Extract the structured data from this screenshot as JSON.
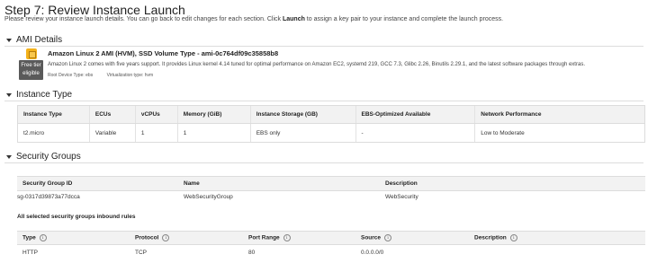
{
  "page": {
    "title": "Step 7: Review Instance Launch",
    "intro_before": "Please review your instance launch details. You can go back to edit changes for each section. Click ",
    "intro_bold": "Launch",
    "intro_after": " to assign a key pair to your instance and complete the launch process."
  },
  "ami": {
    "section_title": "AMI Details",
    "name": "Amazon Linux 2 AMI (HVM), SSD Volume Type - ami-0c764df09c35858b8",
    "badge_line1": "Free tier",
    "badge_line2": "eligible",
    "description": "Amazon Linux 2 comes with five years support. It provides Linux kernel 4.14 tuned for optimal performance on Amazon EC2, systemd 219, GCC 7.3, Glibc 2.26, Binutils 2.29.1, and the latest software packages through extras.",
    "root_device": "Root Device Type: ebs",
    "virtualization": "Virtualization type: hvm"
  },
  "instance_type": {
    "section_title": "Instance Type",
    "headers": [
      "Instance Type",
      "ECUs",
      "vCPUs",
      "Memory (GiB)",
      "Instance Storage (GB)",
      "EBS-Optimized Available",
      "Network Performance"
    ],
    "row": [
      "t2.micro",
      "Variable",
      "1",
      "1",
      "EBS only",
      "-",
      "Low to Moderate"
    ]
  },
  "security_groups": {
    "section_title": "Security Groups",
    "headers": [
      "Security Group ID",
      "Name",
      "Description"
    ],
    "row": [
      "sg-0317d39873a77dcca",
      "WebSecurityGroup",
      "WebSecurity"
    ],
    "rules_title": "All selected security groups inbound rules",
    "rule_headers": [
      "Type",
      "Protocol",
      "Port Range",
      "Source",
      "Description"
    ],
    "rule_row": [
      "HTTP",
      "TCP",
      "80",
      "0.0.0.0/0",
      ""
    ]
  }
}
